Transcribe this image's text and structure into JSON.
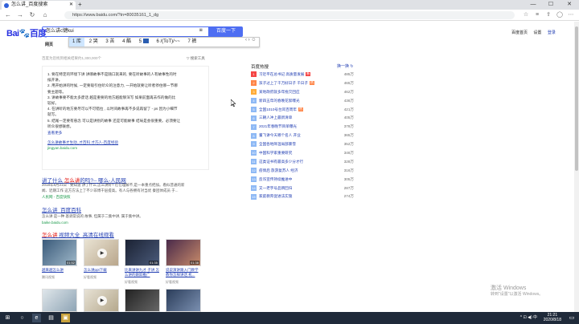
{
  "browser": {
    "tab_title": "怎么讲_百度搜索",
    "new_tab": "+",
    "url": "https://www.baidu.com/?tn=80035161_1_dg",
    "minimize": "—",
    "maximize": "☐",
    "close": "✕"
  },
  "header": {
    "logo_text_a": "Bai",
    "logo_text_paw": "🐾",
    "logo_text_b": "百度",
    "search_value": "怎么讲c键kui",
    "search_button": "百度一下",
    "links": [
      "百度首页",
      "设置",
      "登录"
    ]
  },
  "ime": {
    "candidates": [
      "1 库",
      "2 哭",
      "3 苦",
      "4 酷",
      "5 ",
      "6 /(ToT)/~~",
      "7 裤"
    ],
    "nav": "‹ ›",
    "emoji": "☺"
  },
  "nav_tabs": [
    "网页"
  ],
  "result_count": "百度为您找到相关结果约1,300,000个",
  "filter_label": "搜索工具",
  "card1": {
    "items": [
      "1. 要在特定的环境下讲 讲哪故事不是随口就来的, 要在听故事的人有故事性的时",
      "   候开讲。",
      "2. 用开始讲的时候, 一定要吸引住听众的注意力, 一开始就要让听者停住哪一节哪",
      "   要主题等。",
      "3. 讲故事要不能太多废话 越是重要的地方越能够深写 如果前面再去作的做的比",
      "   较好。",
      "4. 在讲听的地方要尽可以不可错拉 , 以时间故事再不多说再留了 - ps 因为小细节",
      "   就写。",
      "5. 结尾一定要有悬念 可以是讲别的故事 还是可能故事 结局是会很重要。必须要让",
      "   听众很想联想。"
    ],
    "more": "查看更多",
    "source_title": "怎么讲故事才生动_才百科 才巧人-百度经验",
    "domain": "jingyan.baidu.com"
  },
  "results": {
    "r2_title_a": "讲了什么 ",
    "r2_title_hl": "怎么讲",
    "r2_title_b": "的吗?-- 哪么-人民网",
    "r2_line1": "2018年8月21日 - 要知道 讲了什么,怎么讲好? 在在理解不,是一本重点把加。看似普通的新",
    "r2_line2": "闻、近期工作 这方方法上了不少非博干层提高。有人与各拥有对当优 秦团体成员 于...",
    "r2_src": "人民网  -  百度快照",
    "r3_title": "怎么讲_百度百科",
    "r3_line1": "  怎么讲  是一种 基调常说的 故事, 但属于二集中讲, 属于集中讲。",
    "r3_domain": "baike.baidu.com",
    "r4_title_a": "怎么讲",
    "r4_title_b": " 视频大全_高清在线观看"
  },
  "videos": [
    {
      "dur": "01:52",
      "title": "越来越怎么讲",
      "src": "腾讯视频"
    },
    {
      "dur": "",
      "title": "怎么讲ppt下载",
      "src": "好看视频"
    },
    {
      "dur": "01:35",
      "title": "比来讲讲九才 子讲 怎么讲的跟踪推广",
      "src": "好看视频"
    },
    {
      "dur": "01:38",
      "title": "说说演讲跟入门教学 教你怎样讲话 机...",
      "src": "好看视频"
    }
  ],
  "hot": {
    "title": "百度热搜",
    "refresh": "换一换",
    "items": [
      {
        "rank": "1",
        "title": "习近平在总书记 高质量发展",
        "badge": "新",
        "hot": "485万"
      },
      {
        "rank": "2",
        "title": "孩子过上了千万好日子 千日子",
        "badge": "热",
        "hot": "465万"
      },
      {
        "rank": "3",
        "title": "某地政府就多年拖欠回应",
        "badge": "",
        "hot": "462万"
      },
      {
        "rank": "4",
        "title": "新四五年的春晚花絮曝光",
        "badge": "",
        "hot": "436万"
      },
      {
        "rank": "5",
        "title": "全国1010号台风百周年",
        "badge": "热",
        "hot": "421万"
      },
      {
        "rank": "6",
        "title": "三朝人冲上最新清单",
        "badge": "",
        "hot": "405万"
      },
      {
        "rank": "7",
        "title": "2021年春晚节目单曝光",
        "badge": "",
        "hot": "378万"
      },
      {
        "rank": "8",
        "title": "董飞讲今天哪个名人 开业",
        "badge": "",
        "hot": "365万"
      },
      {
        "rank": "9",
        "title": "全国各地降温局部暴雪",
        "badge": "",
        "hot": "352万"
      },
      {
        "rank": "10",
        "title": "中国科学家重要研究",
        "badge": "",
        "hot": "346万"
      },
      {
        "rank": "11",
        "title": "这类证书有最高多少分才行",
        "badge": "",
        "hot": "328万"
      },
      {
        "rank": "12",
        "title": "疫情后 旅游复苏人 经济",
        "badge": "",
        "hot": "316万"
      },
      {
        "rank": "13",
        "title": "反诈宣传持续推进中",
        "badge": "",
        "hot": "305万"
      },
      {
        "rank": "14",
        "title": "又一老字号品牌回归",
        "badge": "",
        "hot": "287万"
      },
      {
        "rank": "15",
        "title": "家庭教育促进法实施",
        "badge": "",
        "hot": "274万"
      }
    ]
  },
  "watermark": {
    "line1": "激活 Windows",
    "line2": "转到\"设置\"以激活 Windows。"
  },
  "taskbar": {
    "clock_time": "21:21",
    "clock_date": "2020/8/18",
    "tray": "^ ⊡ ◀) 中"
  },
  "colors": {
    "accent": "#4e6ef2",
    "link": "#2440b3",
    "logo_red": "#e10601",
    "hot_red": "#f54545",
    "hot_orange": "#ff8547",
    "hot_yellow": "#ffac38",
    "hot_gray": "#8eb9f5"
  }
}
